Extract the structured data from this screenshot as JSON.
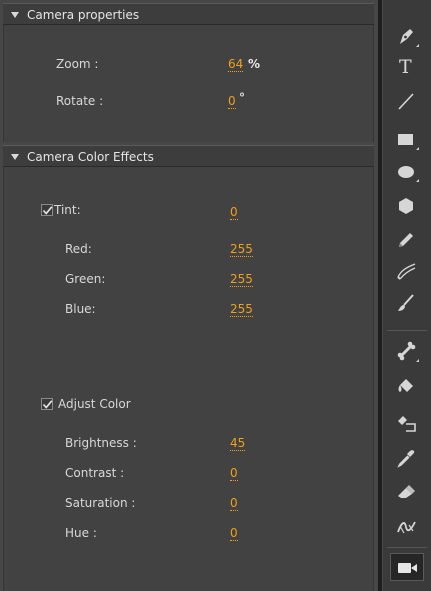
{
  "camera_properties": {
    "title": "Camera properties",
    "zoom_label": "Zoom :",
    "zoom_value": "64",
    "zoom_unit": "%",
    "rotate_label": "Rotate :",
    "rotate_value": "0",
    "rotate_unit": "°"
  },
  "color_effects": {
    "title": "Camera Color Effects",
    "tint": {
      "label": "Tint:",
      "checked": true,
      "value": "0",
      "red_label": "Red:",
      "red_value": "255",
      "green_label": "Green:",
      "green_value": "255",
      "blue_label": "Blue:",
      "blue_value": "255"
    },
    "adjust": {
      "label": "Adjust Color",
      "checked": true,
      "brightness_label": "Brightness :",
      "brightness_value": "45",
      "contrast_label": "Contrast :",
      "contrast_value": "0",
      "saturation_label": "Saturation :",
      "saturation_value": "0",
      "hue_label": "Hue :",
      "hue_value": "0"
    }
  },
  "toolbar": {
    "text_tool_glyph": "T",
    "tools": [
      "pen-tool-icon",
      "text-tool-icon",
      "line-tool-icon",
      "rectangle-tool-icon",
      "oval-tool-icon",
      "polystar-tool-icon",
      "pencil-tool-icon",
      "paint-brush-tool-icon",
      "brush-tool-icon",
      "bone-tool-icon",
      "paint-bucket-tool-icon",
      "ink-bottle-tool-icon",
      "eyedropper-tool-icon",
      "eraser-tool-icon",
      "width-tool-icon",
      "camera-tool-icon"
    ]
  },
  "colors": {
    "accent_value": "#f0a019",
    "panel_bg": "#474747",
    "header_bg": "#3d3d3d",
    "toolbar_bg": "#3a3a3a"
  }
}
